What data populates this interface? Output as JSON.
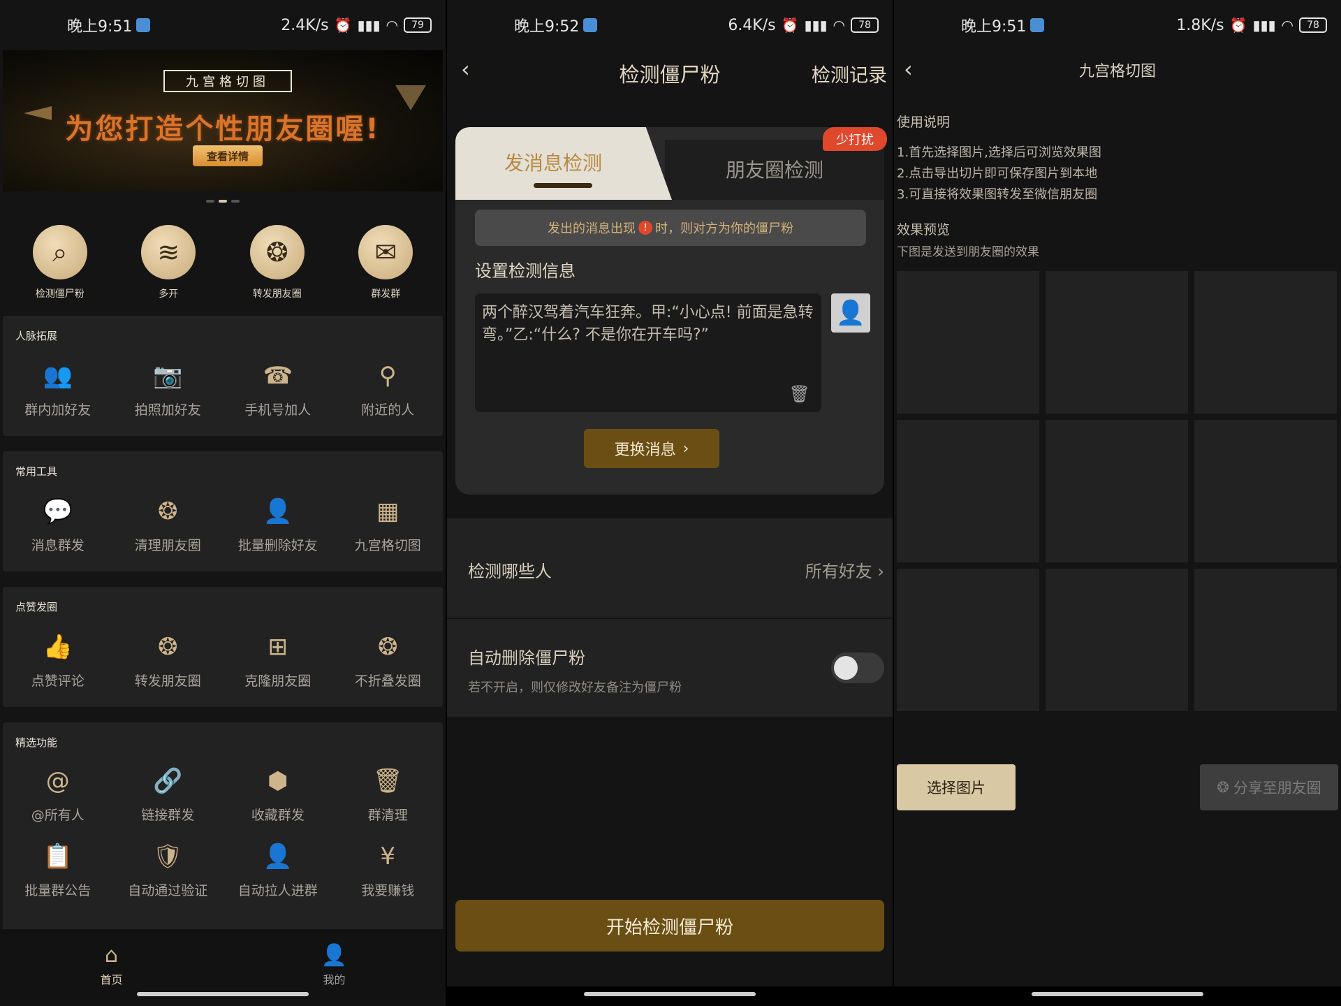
{
  "panel1": {
    "status": {
      "time": "晚上9:51",
      "speed": "2.4K/s",
      "battery": "79"
    },
    "banner": {
      "tag": "九宫格切图",
      "slogan": "为您打造个性朋友圈喔!",
      "button": "查看详情"
    },
    "quick": [
      {
        "label": "检测僵尸粉",
        "icon": "magnifier-pulse-icon"
      },
      {
        "label": "多开",
        "icon": "layers-icon"
      },
      {
        "label": "转发朋友圈",
        "icon": "aperture-icon"
      },
      {
        "label": "群发群",
        "icon": "envelope-icon"
      }
    ],
    "sections": [
      {
        "title": "人脉拓展",
        "items": [
          {
            "label": "群内加好友",
            "icon": "group-users-icon"
          },
          {
            "label": "拍照加好友",
            "icon": "camera-icon"
          },
          {
            "label": "手机号加人",
            "icon": "phone-icon"
          },
          {
            "label": "附近的人",
            "icon": "location-pin-icon"
          }
        ]
      },
      {
        "title": "常用工具",
        "items": [
          {
            "label": "消息群发",
            "icon": "chat-bubbles-icon"
          },
          {
            "label": "清理朋友圈",
            "icon": "aperture-icon"
          },
          {
            "label": "批量删除好友",
            "icon": "user-remove-icon"
          },
          {
            "label": "九宫格切图",
            "icon": "grid-icon"
          }
        ]
      },
      {
        "title": "点赞发圈",
        "items": [
          {
            "label": "点赞评论",
            "icon": "thumbs-up-icon"
          },
          {
            "label": "转发朋友圈",
            "icon": "aperture-icon"
          },
          {
            "label": "克隆朋友圈",
            "icon": "clone-plus-icon"
          },
          {
            "label": "不折叠发圈",
            "icon": "aperture-icon"
          }
        ]
      },
      {
        "title": "精选功能",
        "items": [
          {
            "label": "@所有人",
            "icon": "at-icon"
          },
          {
            "label": "链接群发",
            "icon": "link-icon"
          },
          {
            "label": "收藏群发",
            "icon": "box-icon"
          },
          {
            "label": "群清理",
            "icon": "trash-icon"
          },
          {
            "label": "批量群公告",
            "icon": "notice-icon"
          },
          {
            "label": "自动通过验证",
            "icon": "shield-check-icon"
          },
          {
            "label": "自动拉人进群",
            "icon": "user-add-icon"
          },
          {
            "label": "我要赚钱",
            "icon": "money-bag-icon"
          }
        ]
      }
    ],
    "tabs": [
      {
        "label": "首页",
        "icon": "home-icon"
      },
      {
        "label": "我的",
        "icon": "profile-icon"
      }
    ]
  },
  "panel2": {
    "status": {
      "time": "晚上9:52",
      "speed": "6.4K/s",
      "battery": "78"
    },
    "title": "检测僵尸粉",
    "record": "检测记录",
    "tab_active": "发消息检测",
    "tab_inactive": "朋友圈检测",
    "badge": "少打扰",
    "notice_pre": "发出的消息出现",
    "notice_post": "时，则对方为你的僵尸粉",
    "set_label": "设置检测信息",
    "message": "两个醉汉驾着汽车狂奔。甲:“小心点! 前面是急转弯。”乙:“什么? 不是你在开车吗?”",
    "swap_button": "更换消息",
    "who_label": "检测哪些人",
    "who_value": "所有好友",
    "auto_label": "自动删除僵尸粉",
    "auto_sub": "若不开启，则仅修改好友备注为僵尸粉",
    "auto_on": false,
    "start_button": "开始检测僵尸粉"
  },
  "panel3": {
    "status": {
      "time": "晚上9:51",
      "speed": "1.8K/s",
      "battery": "78"
    },
    "title": "九宫格切图",
    "usage_title": "使用说明",
    "steps": [
      "1.首先选择图片,选择后可浏览效果图",
      "2.点击导出切片即可保存图片到本地",
      "3.可直接将效果图转发至微信朋友圈"
    ],
    "preview_title": "效果预览",
    "preview_sub": "下图是发送到朋友圈的效果",
    "select_button": "选择图片",
    "share_button": "分享至朋友圈"
  }
}
